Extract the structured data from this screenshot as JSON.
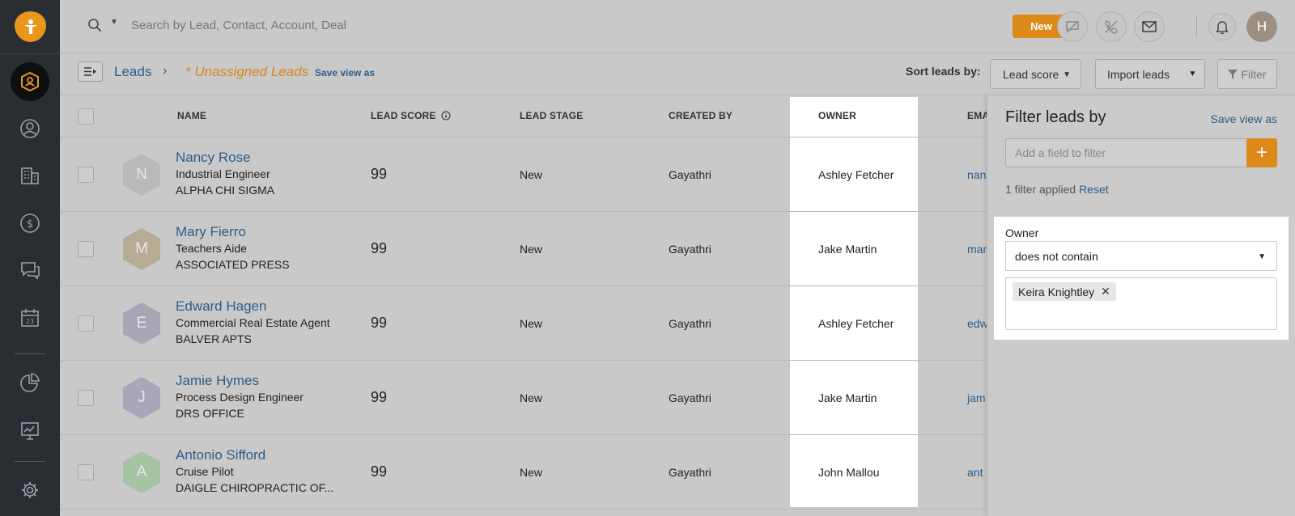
{
  "search": {
    "placeholder": "Search by Lead, Contact, Account, Deal"
  },
  "header": {
    "new_label": "New",
    "avatar_initial": "H"
  },
  "subheader": {
    "breadcrumb_root": "Leads",
    "current_view": "* Unassigned Leads",
    "save_view_label": "Save view as",
    "sort_label": "Sort leads by:",
    "sort_value": "Lead score",
    "import_label": "Import leads",
    "filter_label": "Filter"
  },
  "table": {
    "columns": {
      "name": "NAME",
      "lead_score": "LEAD SCORE",
      "lead_stage": "LEAD STAGE",
      "created_by": "CREATED BY",
      "owner": "OWNER",
      "email": "EMA"
    },
    "rows": [
      {
        "initial": "N",
        "name": "Nancy Rose",
        "title": "Industrial Engineer",
        "company": "ALPHA CHI SIGMA",
        "score": "99",
        "stage": "New",
        "created_by": "Gayathri",
        "owner": "Ashley Fetcher",
        "email": "nan",
        "avatar_color": "#b9b9b9"
      },
      {
        "initial": "M",
        "name": "Mary Fierro",
        "title": "Teachers Aide",
        "company": "ASSOCIATED PRESS",
        "score": "99",
        "stage": "New",
        "created_by": "Gayathri",
        "owner": "Jake Martin",
        "email": "mar",
        "avatar_color": "#b7ab94"
      },
      {
        "initial": "E",
        "name": "Edward Hagen",
        "title": "Commercial Real Estate Agent",
        "company": "BALVER APTS",
        "score": "99",
        "stage": "New",
        "created_by": "Gayathri",
        "owner": "Ashley Fetcher",
        "email": "edw",
        "avatar_color": "#a8a6b4"
      },
      {
        "initial": "J",
        "name": "Jamie Hymes",
        "title": "Process Design Engineer",
        "company": "DRS OFFICE",
        "score": "99",
        "stage": "New",
        "created_by": "Gayathri",
        "owner": "Jake Martin",
        "email": "jam",
        "avatar_color": "#a9a6b9"
      },
      {
        "initial": "A",
        "name": "Antonio Sifford",
        "title": "Cruise Pilot",
        "company": "DAIGLE CHIROPRACTIC OF...",
        "score": "99",
        "stage": "New",
        "created_by": "Gayathri",
        "owner": "John Mallou",
        "email": "ant",
        "avatar_color": "#a6c3a4"
      }
    ]
  },
  "filter_panel": {
    "title": "Filter leads by",
    "save_view_label": "Save view as",
    "add_field_placeholder": "Add a field to filter",
    "applied_text": "1 filter applied",
    "reset_label": "Reset",
    "card": {
      "field_label": "Owner",
      "operator": "does not contain",
      "tags": [
        "Keira Knightley"
      ]
    }
  },
  "colors": {
    "accent": "#dd8a1b",
    "link": "#2b5d87",
    "sidebar": "#2a2d32"
  }
}
